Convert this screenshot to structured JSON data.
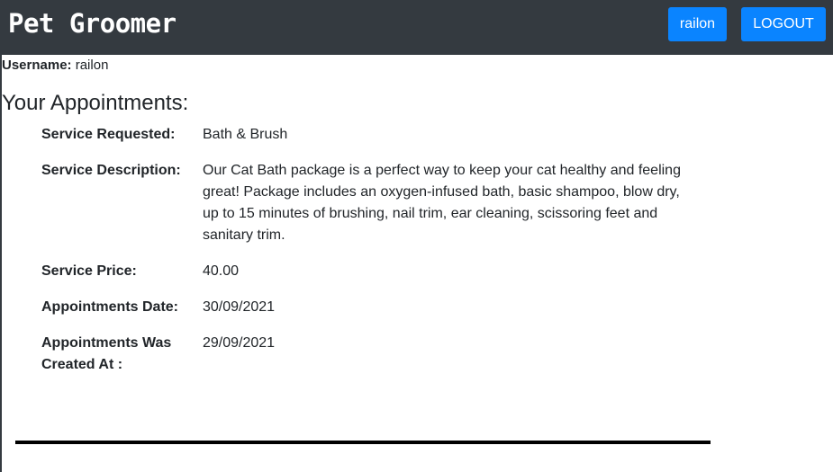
{
  "navbar": {
    "brand": "Pet Groomer",
    "user_button": "railon",
    "logout_button": "LOGOUT"
  },
  "profile": {
    "username_label": "Username:",
    "username_value": "railon"
  },
  "appointments": {
    "title": "Your Appointments:",
    "items": [
      {
        "service_requested_label": "Service Requested:",
        "service_requested": "Bath & Brush",
        "service_description_label": "Service Description:",
        "service_description": "Our Cat Bath package is a perfect way to keep your cat healthy and feeling great! Package includes an oxygen-infused bath, basic shampoo, blow dry, up to 15 minutes of brushing, nail trim, ear cleaning, scissoring feet and sanitary trim.",
        "service_price_label": "Service Price:",
        "service_price": "40.00",
        "appointment_date_label": "Appointments Date:",
        "appointment_date": "30/09/2021",
        "created_at_label": "Appointments Was Created At :",
        "created_at": "29/09/2021"
      }
    ]
  },
  "colors": {
    "navbar_bg": "#343a40",
    "button_bg": "#0a84ff",
    "divider": "#000000"
  }
}
